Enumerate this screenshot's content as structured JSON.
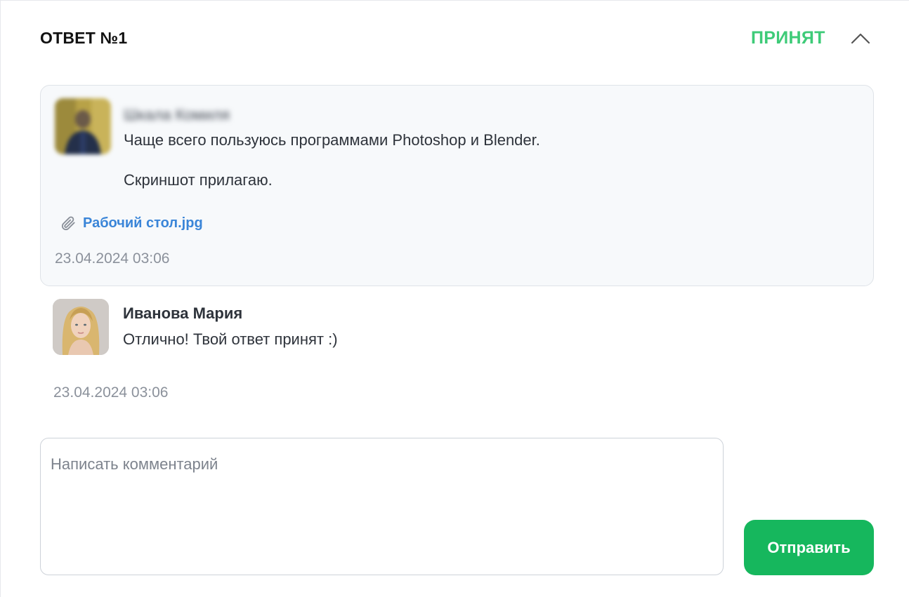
{
  "header": {
    "title": "ОТВЕТ №1",
    "status": "ПРИНЯТ",
    "status_color": "#3ecb78",
    "toggle_icon": "chevron-up-icon"
  },
  "answer": {
    "author": "Шкала Комиля",
    "paragraphs": [
      "Чаще всего пользуюсь программами Photoshop и Blender.",
      "Скриншот прилагаю."
    ],
    "attachment": {
      "icon": "paperclip-icon",
      "file_name": "Рабочий стол.jpg"
    },
    "date": "23.04.2024 03:06"
  },
  "reply": {
    "author": "Иванова Мария",
    "text": "Отлично! Твой ответ принят :)",
    "date": "23.04.2024 03:06"
  },
  "composer": {
    "placeholder": "Написать комментарий",
    "value": "",
    "send_label": "Отправить",
    "send_color": "#16b75d"
  }
}
